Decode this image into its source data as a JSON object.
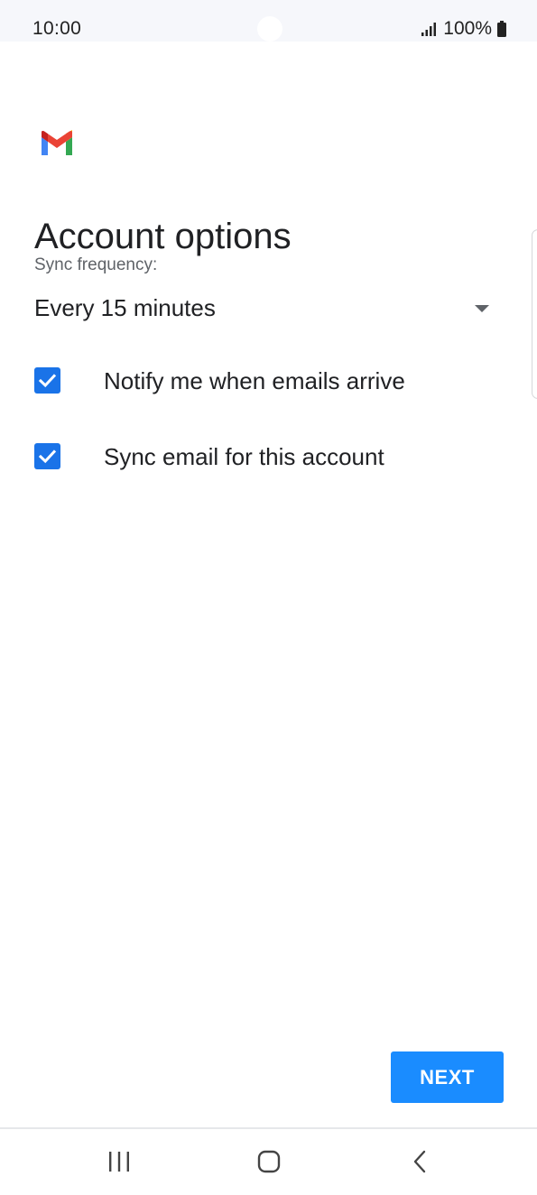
{
  "status_bar": {
    "time": "10:00",
    "battery": "100%",
    "signal_icon": "signal-icon",
    "battery_icon": "battery-icon"
  },
  "app": {
    "logo_icon": "gmail-logo-icon",
    "logo_colors": [
      "#4285f4",
      "#ea4335",
      "#fbbc04",
      "#34a853",
      "#c5221f"
    ]
  },
  "page": {
    "title": "Account options"
  },
  "sync": {
    "label": "Sync frequency:",
    "selected": "Every 15 minutes"
  },
  "options": [
    {
      "label": "Notify me when emails arrive",
      "checked": true
    },
    {
      "label": "Sync email for this account",
      "checked": true
    }
  ],
  "actions": {
    "next_label": "NEXT"
  },
  "navigation": {
    "recents_icon": "recents-icon",
    "home_icon": "home-icon",
    "back_icon": "back-icon"
  },
  "colors": {
    "accent": "#1a73e8",
    "button": "#1a8cff",
    "text": "#202124",
    "secondary_text": "#5f6368"
  }
}
